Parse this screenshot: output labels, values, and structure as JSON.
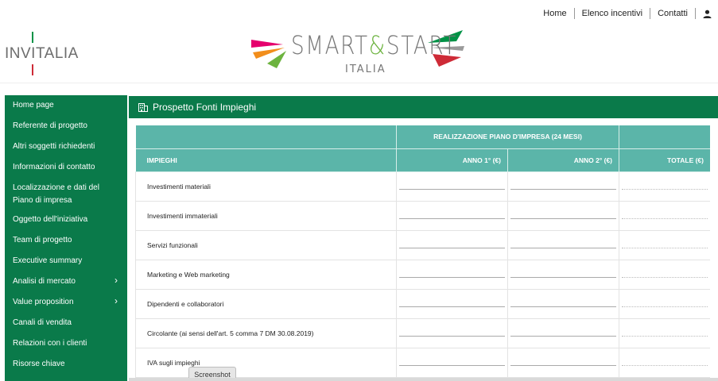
{
  "topnav": {
    "links": [
      "Home",
      "Elenco incentivi",
      "Contatti"
    ],
    "user_icon": "user-icon"
  },
  "logos": {
    "invitalia": "INVITALIA",
    "smartstart": {
      "left": "SMART",
      "amp": "&",
      "right": "START",
      "sub": "ITALIA"
    }
  },
  "sidebar": {
    "items": [
      {
        "label": "Home page",
        "chevron": false
      },
      {
        "label": "Referente di progetto",
        "chevron": false
      },
      {
        "label": "Altri soggetti richiedenti",
        "chevron": false
      },
      {
        "label": "Informazioni di contatto",
        "chevron": false
      },
      {
        "label": "Localizzazione e dati del Piano di impresa",
        "chevron": false
      },
      {
        "label": "Oggetto dell'iniziativa",
        "chevron": false
      },
      {
        "label": "Team di progetto",
        "chevron": false
      },
      {
        "label": "Executive summary",
        "chevron": false
      },
      {
        "label": "Analisi di mercato",
        "chevron": true
      },
      {
        "label": "Value proposition",
        "chevron": true
      },
      {
        "label": "Canali di vendita",
        "chevron": false
      },
      {
        "label": "Relazioni con i clienti",
        "chevron": false
      },
      {
        "label": "Risorse chiave",
        "chevron": false
      }
    ]
  },
  "panel": {
    "title": "Prospetto Fonti Impieghi",
    "icon": "building-icon"
  },
  "table": {
    "group_header": "REALIZZAZIONE PIANO D'IMPRESA (24 MESI)",
    "columns": [
      "IMPIEGHI",
      "ANNO 1° (€)",
      "ANNO 2° (€)",
      "TOTALE (€)"
    ],
    "rows": [
      "Investimenti materiali",
      "Investimenti immateriali",
      "Servizi funzionali",
      "Marketing e Web marketing",
      "Dipendenti e collaboratori",
      "Circolante (ai sensi dell'art. 5 comma 7 DM 30.08.2019)",
      "IVA sugli impieghi"
    ]
  },
  "overlay": {
    "screenshot_label": "Screenshot"
  },
  "colors": {
    "green": "#0a7a4a",
    "teal": "#5bb5a9"
  }
}
